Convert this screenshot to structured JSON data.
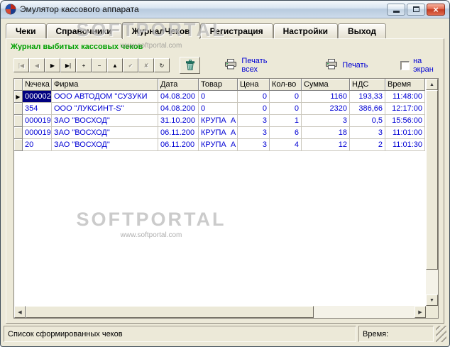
{
  "window": {
    "title": "Эмулятор кассового аппарата"
  },
  "tabs": [
    {
      "name": "tab-cheki",
      "label": "Чеки",
      "active": false
    },
    {
      "name": "tab-spravochniki",
      "label": "Справочники",
      "active": false
    },
    {
      "name": "tab-zhurnal-chekov",
      "label": "ЖурналЧеков",
      "active": true
    },
    {
      "name": "tab-registracija",
      "label": "Регистрация",
      "active": false
    },
    {
      "name": "tab-nastrojki",
      "label": "Настройки",
      "active": false
    },
    {
      "name": "tab-vyhod",
      "label": "Выход",
      "active": false
    }
  ],
  "heading": "Журнал выбитых кассовых чеков",
  "watermark": {
    "title": "SOFTPORTAL",
    "url": "www.softportal.com"
  },
  "toolbar": {
    "nav_buttons": [
      {
        "name": "first",
        "glyph": "|◀",
        "enabled": false
      },
      {
        "name": "prior",
        "glyph": "◀",
        "enabled": false
      },
      {
        "name": "next",
        "glyph": "▶",
        "enabled": true
      },
      {
        "name": "last",
        "glyph": "▶|",
        "enabled": true
      },
      {
        "name": "insert",
        "glyph": "+",
        "enabled": true
      },
      {
        "name": "delete",
        "glyph": "−",
        "enabled": true
      },
      {
        "name": "edit",
        "glyph": "▲",
        "enabled": true
      },
      {
        "name": "post",
        "glyph": "✔",
        "enabled": false
      },
      {
        "name": "cancel",
        "glyph": "✘",
        "enabled": false
      },
      {
        "name": "refresh",
        "glyph": "↻",
        "enabled": true
      }
    ],
    "print_all_label": "Печать всех",
    "print_label": "Печать",
    "to_screen_label": "на экран",
    "to_screen_checked": false
  },
  "grid": {
    "columns": [
      "№чека",
      "Фирма",
      "Дата",
      "Товар",
      "Цена",
      "Кол-во",
      "Сумма",
      "НДС",
      "Время"
    ],
    "rows": [
      [
        "000002",
        "ООО АВТОДОМ \"СУЗУКИ",
        "04.08.200",
        "0",
        "0",
        "0",
        "1160",
        "193,33",
        "11:48:00"
      ],
      [
        "354",
        "ООО \"ЛУКСИНТ-S\"",
        "04.08.200",
        "0",
        "0",
        "0",
        "2320",
        "386,66",
        "12:17:00"
      ],
      [
        "000019",
        "ЗАО \"ВОСХОД\"",
        "31.10.200",
        "КРУПА  А",
        "3",
        "1",
        "3",
        "0,5",
        "15:56:00"
      ],
      [
        "000019",
        "ЗАО \"ВОСХОД\"",
        "06.11.200",
        "КРУПА  А",
        "3",
        "6",
        "18",
        "3",
        "11:01:00"
      ],
      [
        "20",
        "ЗАО \"ВОСХОД\"",
        "06.11.200",
        "КРУПА  А",
        "3",
        "4",
        "12",
        "2",
        "11:01:30"
      ]
    ],
    "selected_row": 0,
    "selected_col": 0,
    "row_indicator_glyph": "▶"
  },
  "statusbar": {
    "left": "Список сформированных чеков",
    "right": "Время:"
  },
  "colors": {
    "panel": "#ECE9D8",
    "heading-green": "#00A000",
    "text-blue": "#0000D4",
    "selection": "#000080",
    "close-red": "#D64937"
  }
}
